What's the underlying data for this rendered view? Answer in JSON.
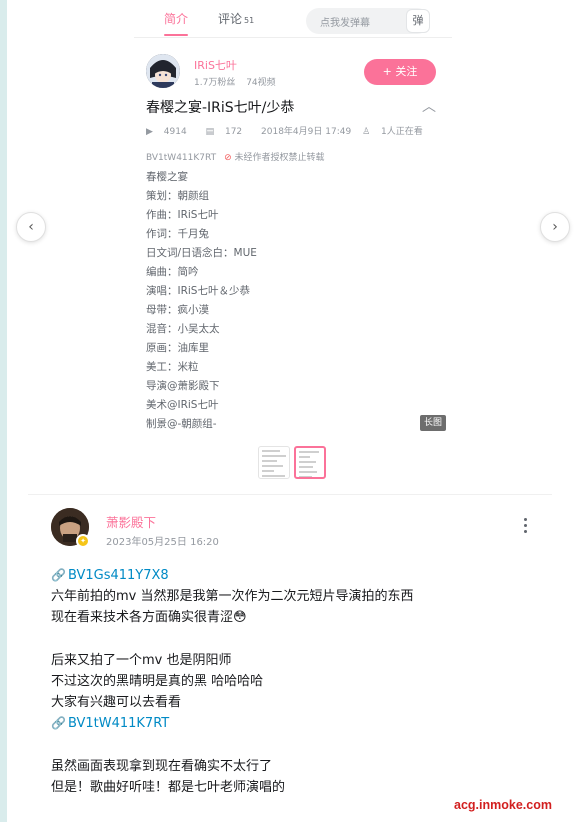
{
  "tabs": [
    {
      "label": "简介"
    },
    {
      "label": "评论",
      "count": "51"
    }
  ],
  "danmu": {
    "placeholder": "点我发弹幕",
    "button": "弹"
  },
  "uploader": {
    "name": "IRiS七叶",
    "fans": "1.7万粉丝",
    "videos": "74视频",
    "follow_label": "+ 关注"
  },
  "video": {
    "title": "春樱之宴-IRiS七叶/少恭",
    "plays": "4914",
    "danmaku": "172",
    "date": "2018年4月9日 17:49",
    "watching": "1人正在看",
    "bvid": "BV1tW411K7RT",
    "repost_notice": "未经作者授权禁止转载",
    "description": [
      "春樱之宴",
      "策划：朝颜组",
      "作曲：IRiS七叶",
      "作词：千月兔",
      "日文词/日语念白：MUE",
      "编曲：简吟",
      "演唱：IRiS七叶＆少恭",
      "母带：疯小漠",
      "混音：小吴太太",
      "原画：油库里",
      "美工：米粒",
      "导演@萧影殿下",
      "美术@IRiS七叶",
      "制景@-朝颜组-"
    ],
    "long_image_badge": "长图"
  },
  "comment": {
    "user": "萧影殿下",
    "time": "2023年05月25日 16:20",
    "body": [
      {
        "type": "link",
        "text": "BV1Gs411Y7X8"
      },
      {
        "type": "text",
        "text": "六年前拍的mv 当然那是我第一次作为二次元短片导演拍的东西"
      },
      {
        "type": "text",
        "text": "现在看来技术各方面确实很青涩😳"
      },
      {
        "type": "gap"
      },
      {
        "type": "text",
        "text": "后来又拍了一个mv 也是阴阳师"
      },
      {
        "type": "text",
        "text": "不过这次的黑晴明是真的黑 哈哈哈哈"
      },
      {
        "type": "text",
        "text": "大家有兴趣可以去看看"
      },
      {
        "type": "link",
        "text": "BV1tW411K7RT"
      },
      {
        "type": "gap"
      },
      {
        "type": "text",
        "text": "虽然画面表现拿到现在看确实不太行了"
      },
      {
        "type": "text",
        "text": "但是！歌曲好听哇！都是七叶老师演唱的"
      }
    ]
  },
  "watermark": "acg.inmoke.com",
  "colors": {
    "accent": "#fb7299",
    "link": "#008ac5",
    "watermark": "#d21f1f"
  },
  "icons": [
    "play-count-icon",
    "danmaku-icon",
    "viewers-icon",
    "forbidden-icon",
    "chevron-up-icon",
    "chevron-left-icon",
    "chevron-right-icon",
    "link-icon",
    "more-icon",
    "vip-badge-icon"
  ]
}
